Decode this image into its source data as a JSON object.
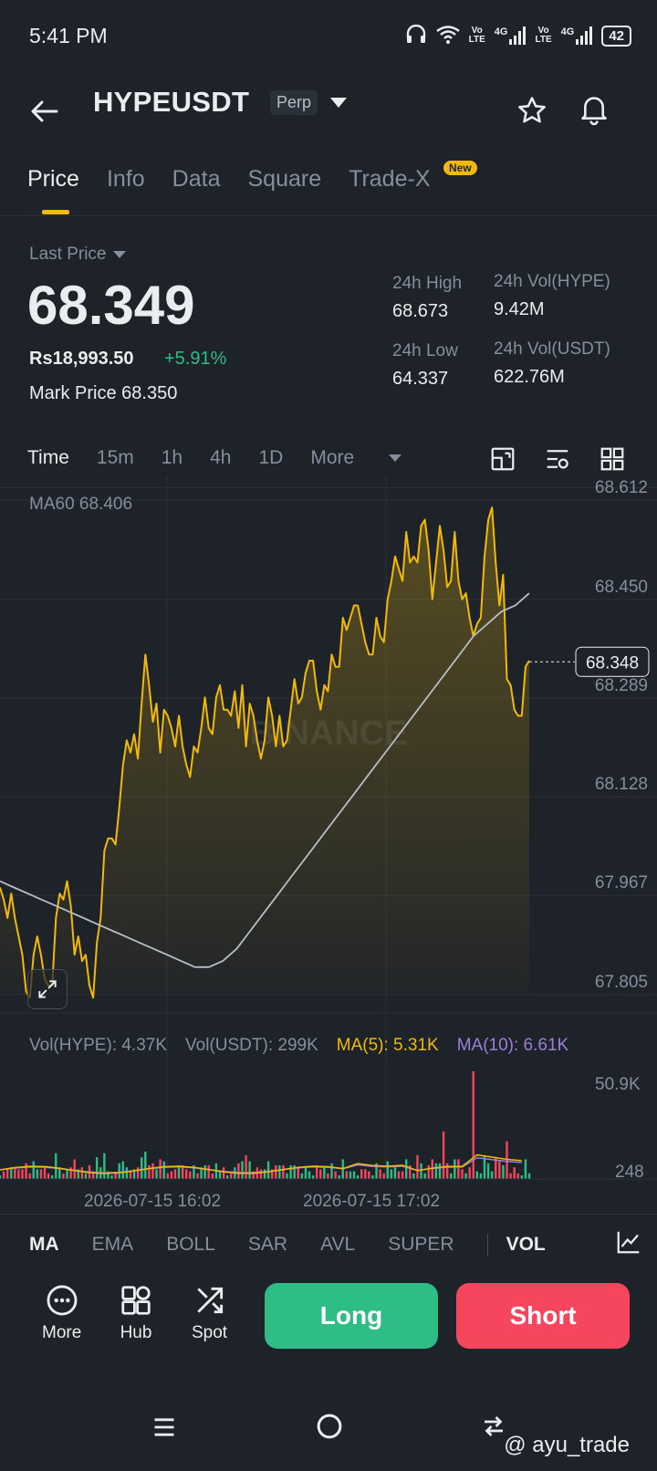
{
  "status_bar": {
    "time": "5:41 PM",
    "network_1": "4G",
    "network_2": "4G",
    "volte_1": "Vo\nLTE",
    "volte_2": "Vo\nLTE",
    "battery": "42"
  },
  "header": {
    "symbol": "HYPEUSDT",
    "contract_type": "Perp"
  },
  "tabs": [
    {
      "label": "Price"
    },
    {
      "label": "Info"
    },
    {
      "label": "Data"
    },
    {
      "label": "Square"
    },
    {
      "label": "Trade-X",
      "badge": "New"
    }
  ],
  "ticker": {
    "last_price_label": "Last Price",
    "last_price": "68.349",
    "fiat_price": "Rs18,993.50",
    "change_pct": "+5.91%",
    "mark_price_label": "Mark Price",
    "mark_price": "68.350",
    "high_label": "24h High",
    "high": "68.673",
    "low_label": "24h Low",
    "low": "64.337",
    "vol_base_label": "24h Vol(HYPE)",
    "vol_base": "9.42M",
    "vol_quote_label": "24h Vol(USDT)",
    "vol_quote": "622.76M"
  },
  "intervals": {
    "items": [
      "Time",
      "15m",
      "1h",
      "4h",
      "1D"
    ],
    "more": "More",
    "selected": "Time"
  },
  "chart_data": {
    "type": "area",
    "symbol": "HYPEUSDT",
    "ma_label": "MA60 68.406",
    "yticks": [
      68.612,
      68.45,
      68.289,
      68.128,
      67.967,
      67.805
    ],
    "ylim": [
      67.805,
      68.612
    ],
    "current_price_tag": "68.348",
    "watermark": "BINANCE",
    "xticks": [
      "2026-07-15 16:02",
      "2026-07-15 17:02"
    ],
    "price": [
      67.98,
      67.96,
      67.93,
      67.97,
      67.93,
      67.9,
      67.87,
      67.81,
      67.8,
      67.87,
      67.9,
      67.87,
      67.83,
      67.82,
      67.82,
      67.93,
      67.97,
      67.96,
      67.99,
      67.95,
      67.87,
      67.9,
      67.86,
      67.87,
      67.82,
      67.8,
      67.89,
      67.93,
      68.04,
      68.06,
      68.06,
      68.05,
      68.11,
      68.18,
      68.22,
      68.2,
      68.23,
      68.19,
      68.28,
      68.36,
      68.31,
      68.25,
      68.28,
      68.2,
      68.27,
      68.26,
      68.24,
      68.21,
      68.26,
      68.21,
      68.18,
      68.16,
      68.21,
      68.2,
      68.24,
      68.29,
      68.24,
      68.23,
      68.29,
      68.31,
      68.27,
      68.27,
      68.26,
      68.3,
      68.24,
      68.31,
      68.21,
      68.28,
      68.26,
      68.22,
      68.19,
      68.22,
      68.29,
      68.26,
      68.21,
      68.26,
      68.21,
      68.22,
      68.27,
      68.32,
      68.28,
      68.29,
      68.33,
      68.35,
      68.35,
      68.3,
      68.27,
      68.31,
      68.3,
      68.36,
      68.34,
      68.34,
      68.42,
      68.4,
      68.42,
      68.44,
      68.44,
      68.41,
      68.38,
      68.36,
      68.36,
      68.42,
      68.39,
      68.38,
      68.45,
      68.48,
      68.52,
      68.5,
      68.48,
      68.56,
      68.51,
      68.52,
      68.51,
      68.57,
      68.58,
      68.53,
      68.45,
      68.51,
      68.57,
      68.53,
      68.47,
      68.48,
      68.56,
      68.48,
      68.45,
      68.46,
      68.42,
      68.39,
      68.41,
      68.42,
      68.52,
      68.58,
      68.6,
      68.51,
      68.44,
      68.49,
      68.32,
      68.31,
      68.27,
      68.26,
      68.26,
      68.34,
      68.35
    ],
    "ma60": [
      67.99,
      67.98,
      67.97,
      67.96,
      67.95,
      67.94,
      67.93,
      67.92,
      67.91,
      67.9,
      67.89,
      67.88,
      67.87,
      67.86,
      67.85,
      67.85,
      67.86,
      67.88,
      67.91,
      67.94,
      67.97,
      68.0,
      68.03,
      68.06,
      68.09,
      68.12,
      68.15,
      68.18,
      68.21,
      68.24,
      68.27,
      68.3,
      68.33,
      68.36,
      68.39,
      68.41,
      68.43,
      68.44,
      68.46
    ],
    "volume": {
      "label_base": "Vol(HYPE): 4.37K",
      "label_quote": "Vol(USDT): 299K",
      "ma5_label": "MA(5): 5.31K",
      "ma10_label": "MA(10): 6.61K",
      "ymax": "50.9K",
      "ymin": "248"
    },
    "colors": {
      "line": "#f0b90b",
      "ma60": "#b7bdc6",
      "ma5": "#f0b90b",
      "ma10": "#9b7ed9",
      "up": "#2ebd85",
      "down": "#f6465d"
    }
  },
  "indicators": {
    "items": [
      "MA",
      "EMA",
      "BOLL",
      "SAR",
      "AVL",
      "SUPER",
      "VOL"
    ],
    "selected_main": "MA",
    "selected_sub": "VOL"
  },
  "bottom_bar": {
    "more": "More",
    "hub": "Hub",
    "spot": "Spot",
    "long": "Long",
    "short": "Short",
    "long_color": "#2ebd85",
    "short_color": "#f6465d"
  },
  "watermark": "@ ayu_trade"
}
